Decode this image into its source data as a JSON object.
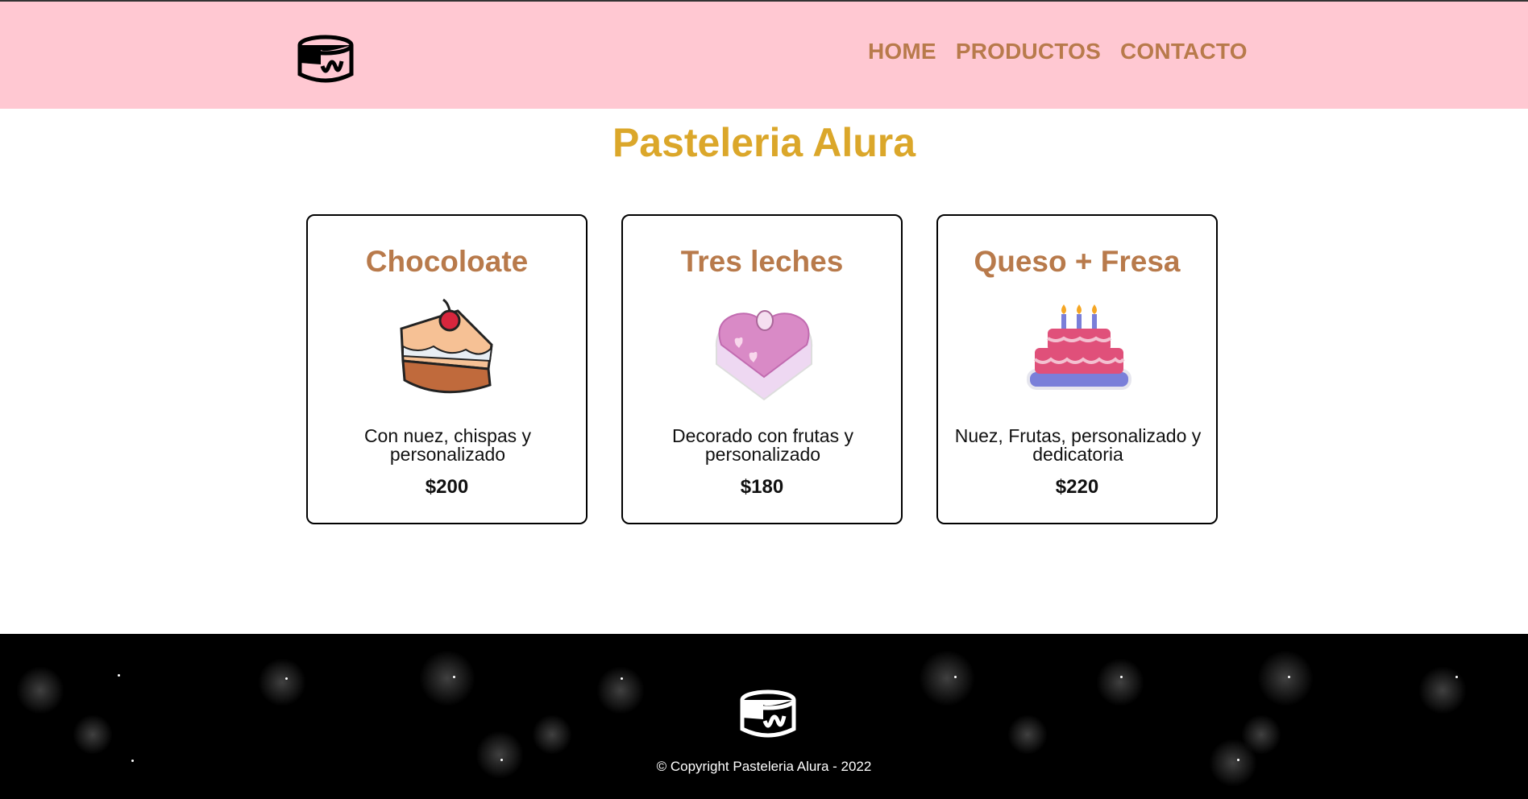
{
  "nav": {
    "home": "HOME",
    "products": "PRODUCTOS",
    "contact": "CONTACTO"
  },
  "page_title": "Pasteleria Alura",
  "cards": [
    {
      "title": "Chocoloate",
      "description": "Con nuez, chispas y personalizado",
      "price": "$200",
      "icon": "chocolate-cake-slice-icon"
    },
    {
      "title": "Tres leches",
      "description": "Decorado con frutas y personalizado",
      "price": "$180",
      "icon": "heart-cake-icon"
    },
    {
      "title": "Queso + Fresa",
      "description": "Nuez, Frutas, personalizado y dedicatoria",
      "price": "$220",
      "icon": "birthday-cake-icon"
    }
  ],
  "footer": {
    "copyright": "© Copyright Pasteleria Alura - 2022"
  },
  "colors": {
    "header_bg": "#ffc8d2",
    "nav_link": "#b87a4b",
    "title": "#dba72a",
    "footer_bg": "#000000"
  }
}
